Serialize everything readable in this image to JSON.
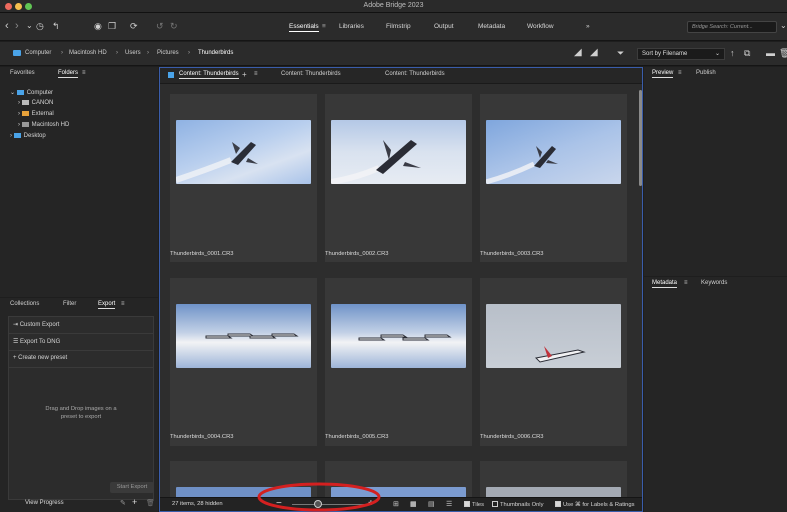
{
  "app": {
    "title": "Adobe Bridge 2023"
  },
  "workspaces": [
    {
      "label": "Essentials",
      "active": true
    },
    {
      "label": "Libraries"
    },
    {
      "label": "Filmstrip"
    },
    {
      "label": "Output"
    },
    {
      "label": "Metadata"
    },
    {
      "label": "Workflow"
    },
    {
      "label": "»"
    }
  ],
  "search": {
    "placeholder": "Bridge Search: Current..."
  },
  "path": {
    "items": [
      "Computer",
      "Macintosh HD",
      "Users",
      "Pictures",
      "Thunderbirds"
    ]
  },
  "sort": {
    "value": "Sort by Filename"
  },
  "left_top": {
    "tabs": [
      "Favorites",
      "Folders"
    ],
    "tree": [
      "Computer",
      "CANON",
      "External",
      "Macintosh HD",
      "Desktop"
    ]
  },
  "left_bottom": {
    "tabs": [
      "Collections",
      "Filter",
      "Export"
    ],
    "items": [
      "Custom Export",
      "Export To DNG",
      "Create new preset"
    ],
    "hint": "Drag and Drop images on a preset to export",
    "start_export": "Start Export",
    "view_progress": "View Progress"
  },
  "content": {
    "tabs": [
      "Content: Thunderbirds",
      "Content: Thunderbirds",
      "Content: Thunderbirds"
    ],
    "thumbnails": [
      {
        "name": "Thunderbirds_0001.CR3"
      },
      {
        "name": "Thunderbirds_0002.CR3"
      },
      {
        "name": "Thunderbirds_0003.CR3"
      },
      {
        "name": "Thunderbirds_0004.CR3"
      },
      {
        "name": "Thunderbirds_0005.CR3"
      },
      {
        "name": "Thunderbirds_0006.CR3"
      }
    ],
    "status": "27 items, 28 hidden",
    "zoom_minus": "−",
    "zoom_plus": "+",
    "tiles": "Tiles",
    "thumbs_only": "Thumbnails Only",
    "use_cmd": "Use ⌘ for Labels & Ratings"
  },
  "right_top": {
    "tabs": [
      "Preview",
      "Publish"
    ]
  },
  "right_bottom": {
    "tabs": [
      "Metadata",
      "Keywords"
    ]
  }
}
